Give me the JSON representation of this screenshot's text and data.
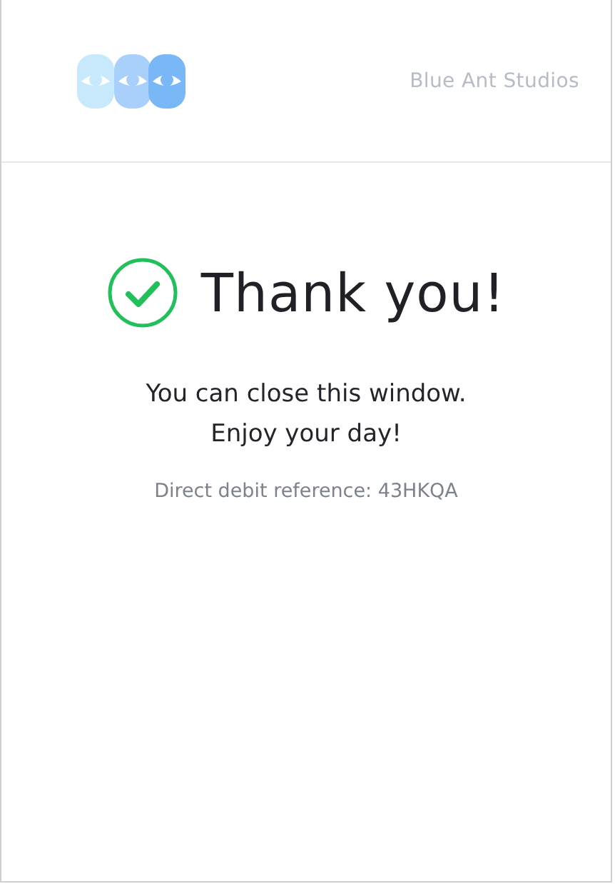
{
  "header": {
    "company": "Blue Ant Studios"
  },
  "confirmation": {
    "title": "Thank you!",
    "message_lines": [
      "You can close this window.",
      "Enjoy your day!"
    ],
    "reference": "Direct debit reference: 43HKQA"
  }
}
